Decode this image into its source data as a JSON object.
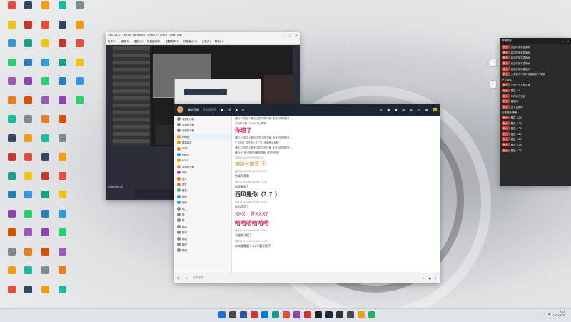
{
  "obs": {
    "title": "OBS 28.0.1 (64-bit, windows) - 配置文件: 未命名 - 场景: 场景",
    "menu": [
      "文件(F)",
      "编辑(E)",
      "视图(V)",
      "停靠窗口(D)",
      "配置文件(P)",
      "场景集合(S)",
      "工具(T)",
      "帮助(H)"
    ],
    "dock_title": "场景来源分类"
  },
  "chat": {
    "window_title": "猫吃马桶",
    "member_count": "2456909",
    "counter": "16",
    "side_items": [
      "马猫吃马桶",
      "马猫吃马桶",
      "马猫吃马桶",
      "IMM桌",
      "猫猫桌灰",
      "NICE",
      "Bosss",
      "BOSS",
      "马猫吃马桶",
      "明东",
      "源方",
      "源方",
      "腾星",
      "新阳",
      "新阳",
      "明二",
      "猫",
      "群",
      "群组",
      "群组",
      "群组",
      "群组",
      "群组"
    ],
    "messages": [
      {
        "kind": "sys",
        "text": "通知: 与陌生人聊天注意 谨防诈骗, 如有问题请联系..."
      },
      {
        "kind": "sys",
        "text": "马猫吃马桶 (2345) 加入群聊"
      },
      {
        "kind": "big",
        "text": "你进了",
        "color": "#d11f55"
      },
      {
        "kind": "sys",
        "text": "通知: 与陌生人聊天注意 谨防诈骗, 如有问题请联系..."
      },
      {
        "kind": "sys",
        "text": "广告投放 群内禁止发广告, 违者移出本群~"
      },
      {
        "kind": "sys",
        "text": "通知: 与陌生人聊天注意 谨防诈骗, 如有问题请联系..."
      },
      {
        "kind": "sys",
        "text": "通知: 已进入猫吃马桶的群聊, 请遵守群规"
      },
      {
        "kind": "meta",
        "text": "马猫(2345979)05 03:23"
      },
      {
        "kind": "color",
        "text": "900分加罗 王",
        "color": "#e67e22"
      },
      {
        "kind": "meta",
        "text": "猫吃(2345448)05 03:23:09"
      },
      {
        "kind": "txt",
        "text": "完成声音啊"
      },
      {
        "kind": "meta",
        "text": "猫吃(2345448)05 03:23:53"
      },
      {
        "kind": "txt",
        "text": "你是哪里?"
      },
      {
        "kind": "big",
        "text": "西风是你（？？）",
        "color": "#222"
      },
      {
        "kind": "meta",
        "text": "猫吃(2345448)05 03:25:23"
      },
      {
        "kind": "txt",
        "text": "你的声音了"
      },
      {
        "kind": "color",
        "text": "XXX　是XXX?",
        "color": "#d11f55"
      },
      {
        "kind": "big",
        "text": "哈哈哈哈哈哈",
        "color": "#d11f55"
      },
      {
        "kind": "meta",
        "text": "猫吃(2345448)05 03:26:03"
      },
      {
        "kind": "txt",
        "text": "马猫吃马桶了"
      },
      {
        "kind": "meta",
        "text": "猫吃(2345448)05 03:27:47"
      },
      {
        "kind": "txt",
        "text": "你知道是猫了 xx不要声音了"
      }
    ],
    "input_placeholder": "@群聊里..."
  },
  "danmaku": {
    "title": "弹幕助手",
    "rows": [
      {
        "badge": "粉丝",
        "text": "欢迎来到本直播间"
      },
      {
        "badge": "粉丝",
        "text": "欢迎来到本直播间"
      },
      {
        "badge": "粉丝",
        "text": "欢迎来到本直播间"
      },
      {
        "badge": "粉丝",
        "text": "欢迎来到本直播间"
      },
      {
        "badge": "粉丝",
        "text": "欢迎来到本直播间"
      },
      {
        "badge": "粉丝",
        "text": "大牛猫下下次再去直播间下半场"
      },
      {
        "badge": "",
        "text": "护卫猫猫"
      },
      {
        "badge": "粉丝",
        "text": "不准一个人物好像"
      },
      {
        "badge": "粉丝",
        "text": "赠送 ×1"
      },
      {
        "badge": "粉丝",
        "text": "你你对在说话"
      },
      {
        "badge": "粉丝",
        "text": "直播吧"
      },
      {
        "badge": "粉丝",
        "text": "进入直播间"
      },
      {
        "badge": "",
        "text": "云播图标 弹幕"
      },
      {
        "badge": "粉丝",
        "text": "赠送 ×20"
      },
      {
        "badge": "粉丝",
        "text": "赠送 ×20"
      },
      {
        "badge": "粉丝",
        "text": "赠送 ×20"
      },
      {
        "badge": "粉丝",
        "text": "赠送 ×20"
      },
      {
        "badge": "粉丝",
        "text": "赠送 ×20"
      },
      {
        "badge": "粉丝",
        "text": "赠送 ×20"
      },
      {
        "badge": "粉丝",
        "text": "赠送 ×20"
      }
    ]
  },
  "taskbar": {
    "time": "0:25",
    "date": "2022/6/28",
    "colors": [
      "#1e6fd9",
      "#444",
      "#2b579a",
      "#d13438",
      "#0078d4",
      "#16a085",
      "#e74c3c",
      "#8e44ad",
      "#c0392b",
      "#222",
      "#1b2838",
      "#333",
      "#4a4a4a",
      "#f39c12",
      "#27ae60"
    ]
  },
  "desktop": {
    "colors": [
      "#e74c3c",
      "#f1c40f",
      "#3498db",
      "#2ecc71",
      "#9b59b6",
      "#e67e22",
      "#1abc9c",
      "#34495e",
      "#c0392b",
      "#16a085",
      "#2980b9",
      "#8e44ad",
      "#d35400",
      "#7f8c8d",
      "#f39c12"
    ]
  }
}
